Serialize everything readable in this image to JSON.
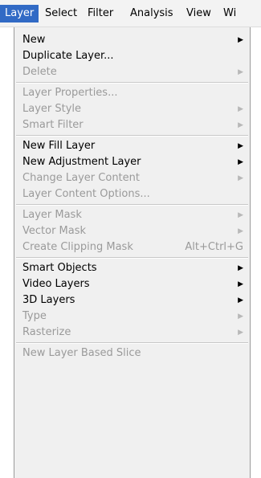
{
  "menubar": {
    "items": [
      {
        "label": "Layer",
        "active": true
      },
      {
        "label": "Select"
      },
      {
        "label": "Filter"
      },
      {
        "label": "Analysis"
      },
      {
        "label": "View"
      },
      {
        "label": "Wi"
      }
    ]
  },
  "menu": {
    "groups": [
      [
        {
          "label": "New",
          "enabled": true,
          "submenu": true
        },
        {
          "label": "Duplicate Layer...",
          "enabled": true
        },
        {
          "label": "Delete",
          "enabled": false,
          "submenu": true
        }
      ],
      [
        {
          "label": "Layer Properties...",
          "enabled": false
        },
        {
          "label": "Layer Style",
          "enabled": false,
          "submenu": true
        },
        {
          "label": "Smart Filter",
          "enabled": false,
          "submenu": true
        }
      ],
      [
        {
          "label": "New Fill Layer",
          "enabled": true,
          "submenu": true
        },
        {
          "label": "New Adjustment Layer",
          "enabled": true,
          "submenu": true
        },
        {
          "label": "Change Layer Content",
          "enabled": false,
          "submenu": true
        },
        {
          "label": "Layer Content Options...",
          "enabled": false
        }
      ],
      [
        {
          "label": "Layer Mask",
          "enabled": false,
          "submenu": true
        },
        {
          "label": "Vector Mask",
          "enabled": false,
          "submenu": true
        },
        {
          "label": "Create Clipping Mask",
          "enabled": false,
          "shortcut": "Alt+Ctrl+G"
        }
      ],
      [
        {
          "label": "Smart Objects",
          "enabled": true,
          "submenu": true
        },
        {
          "label": "Video Layers",
          "enabled": true,
          "submenu": true
        },
        {
          "label": "3D Layers",
          "enabled": true,
          "submenu": true
        },
        {
          "label": "Type",
          "enabled": false,
          "submenu": true
        },
        {
          "label": "Rasterize",
          "enabled": false,
          "submenu": true
        }
      ],
      [
        {
          "label": "New Layer Based Slice",
          "enabled": false
        }
      ]
    ]
  },
  "icons": {
    "submenu_arrow": "submenu-arrow-icon"
  },
  "colors": {
    "highlight": "#316ac5",
    "disabled_text": "#9a9a9a",
    "menu_bg": "#f0f0f0"
  }
}
